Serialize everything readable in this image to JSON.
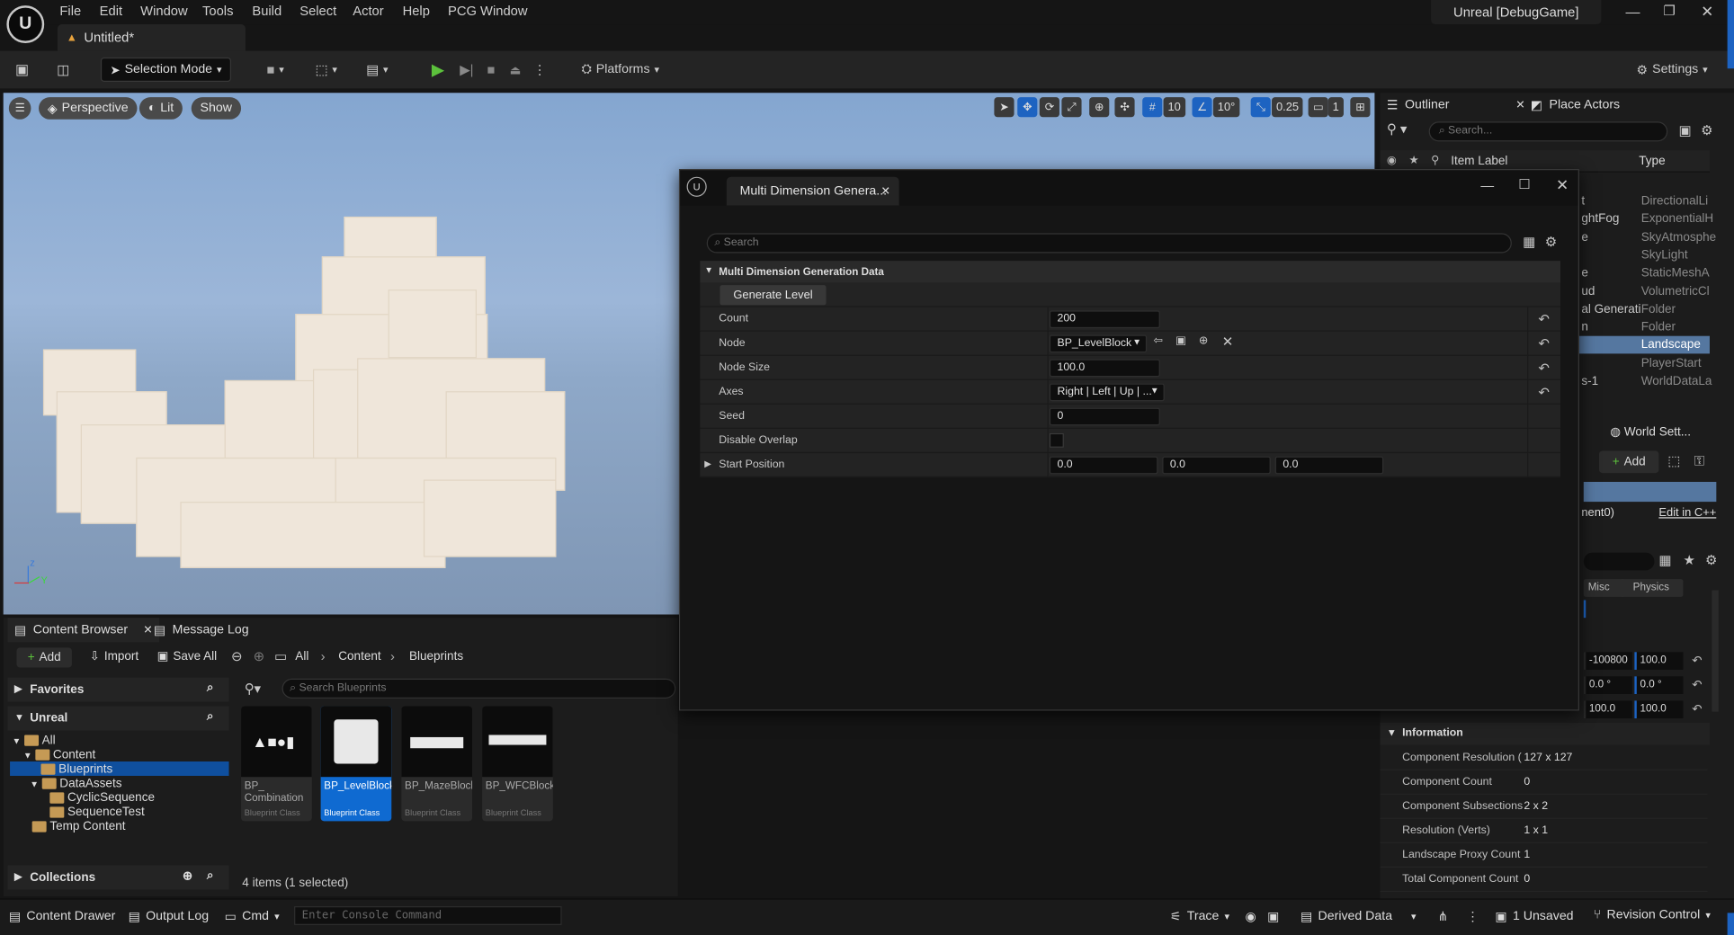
{
  "menu": {
    "items": [
      "File",
      "Edit",
      "Window",
      "Tools",
      "Build",
      "Select",
      "Actor",
      "Help",
      "PCG Window"
    ],
    "window_title": "Unreal [DebugGame]"
  },
  "doc_tab": {
    "label": "Untitled*"
  },
  "toolbar": {
    "selection_mode": "Selection Mode",
    "platforms": "Platforms",
    "settings": "Settings"
  },
  "viewport": {
    "perspective": "Perspective",
    "lit": "Lit",
    "show": "Show",
    "grid_snap": "10",
    "rotate_snap": "10°",
    "scale_snap": "0.25",
    "camera_speed": "1",
    "axis_z": "z",
    "axis_y": "Y"
  },
  "outliner": {
    "tab": "Outliner",
    "place_actors": "Place Actors",
    "search_placeholder": "Search...",
    "col_label": "Item Label",
    "col_type": "Type",
    "rows": [
      {
        "label": "t",
        "type": "DirectionalLi"
      },
      {
        "label": "ghtFog",
        "type": "ExponentialH"
      },
      {
        "label": "e",
        "type": "SkyAtmosphe"
      },
      {
        "label": "",
        "type": "SkyLight"
      },
      {
        "label": "e",
        "type": "StaticMeshA"
      },
      {
        "label": "ud",
        "type": "VolumetricCl"
      },
      {
        "label": "al Generati",
        "type": "Folder"
      },
      {
        "label": "n",
        "type": "Folder"
      },
      {
        "label": "",
        "type": "Landscape"
      },
      {
        "label": "",
        "type": "PlayerStart"
      },
      {
        "label": "s-1",
        "type": "WorldDataLa"
      }
    ],
    "world_settings": "World Sett...",
    "add": "Add",
    "component_label": "nent0)",
    "edit_in_cpp": "Edit in C++",
    "tab_misc": "Misc",
    "tab_physics": "Physics",
    "transform_rows": [
      [
        "-100800",
        "100.0"
      ],
      [
        "0.0 °",
        "0.0 °"
      ],
      [
        "100.0",
        "100.0"
      ]
    ],
    "information_header": "Information",
    "info": [
      {
        "k": "Component Resolution (",
        "v": "127 x 127"
      },
      {
        "k": "Component Count",
        "v": "0"
      },
      {
        "k": "Component Subsections",
        "v": "2 x 2"
      },
      {
        "k": "Resolution (Verts)",
        "v": "1 x 1"
      },
      {
        "k": "Landscape Proxy Count",
        "v": "1"
      },
      {
        "k": "Total Component Count",
        "v": "0"
      }
    ]
  },
  "content_browser": {
    "tab": "Content Browser",
    "tab2": "Message Log",
    "add": "Add",
    "import": "Import",
    "save_all": "Save All",
    "crumbs": [
      "All",
      "Content",
      "Blueprints"
    ],
    "favorites": "Favorites",
    "unreal": "Unreal",
    "tree": [
      "All",
      "Content",
      "Blueprints",
      "DataAssets",
      "CyclicSequence",
      "SequenceTest",
      "Temp Content"
    ],
    "collections": "Collections",
    "search_placeholder": "Search Blueprints",
    "assets": [
      {
        "name": "BP_\nCombination",
        "cls": "Blueprint Class"
      },
      {
        "name": "BP_LevelBlock",
        "cls": "Blueprint Class"
      },
      {
        "name": "BP_MazeBlock",
        "cls": "Blueprint Class"
      },
      {
        "name": "BP_WFCBlock",
        "cls": "Blueprint Class"
      }
    ],
    "count": "4 items (1 selected)"
  },
  "dialog": {
    "title": "Multi Dimension Genera...",
    "search_placeholder": "Search",
    "section": "Multi Dimension Generation Data",
    "generate": "Generate Level",
    "props": {
      "count_label": "Count",
      "count": "200",
      "node_label": "Node",
      "node": "BP_LevelBlock",
      "node_size_label": "Node Size",
      "node_size": "100.0",
      "axes_label": "Axes",
      "axes": "Right | Left | Up | ...",
      "seed_label": "Seed",
      "seed": "0",
      "overlap_label": "Disable Overlap",
      "start_label": "Start Position",
      "sx": "0.0",
      "sy": "0.0",
      "sz": "0.0"
    }
  },
  "statusbar": {
    "content_drawer": "Content Drawer",
    "output_log": "Output Log",
    "cmd": "Cmd",
    "console_placeholder": "Enter Console Command",
    "trace": "Trace",
    "derived_data": "Derived Data",
    "unsaved": "1 Unsaved",
    "revision_control": "Revision Control"
  }
}
